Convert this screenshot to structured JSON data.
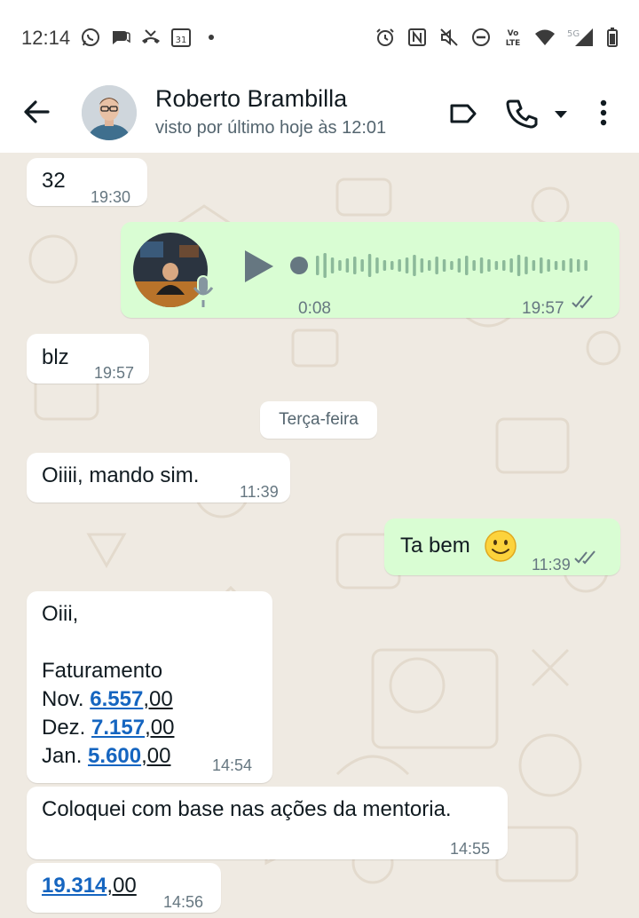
{
  "status_bar": {
    "time": "12:14",
    "left_icons": [
      "whatsapp-icon",
      "chat-icon",
      "missed-call-icon",
      "calendar-icon",
      "dot-icon"
    ],
    "calendar_day": "31",
    "right_icons": [
      "alarm-icon",
      "nfc-icon",
      "mute-icon",
      "dnd-icon",
      "volte-icon",
      "wifi-icon",
      "signal-icon",
      "battery-icon"
    ],
    "volte_label": "Vo LTE",
    "network_label": "5G"
  },
  "header": {
    "contact_name": "Roberto Brambilla",
    "contact_status": "visto por último hoje às 12:01",
    "icons": [
      "back-arrow-icon",
      "label-icon",
      "call-icon",
      "dropdown-icon",
      "more-icon"
    ]
  },
  "chat": {
    "date_separator": "Terça-feira",
    "messages": [
      {
        "dir": "in",
        "text": "32",
        "time": "19:30"
      },
      {
        "dir": "out",
        "type": "voice",
        "duration": "0:08",
        "time": "19:57",
        "status": "read"
      },
      {
        "dir": "in",
        "text": "blz",
        "time": "19:57"
      },
      {
        "dir": "in",
        "text": "Oiiii, mando sim.",
        "time": "11:39"
      },
      {
        "dir": "out",
        "text": "Ta bem",
        "emoji": "slightly-smiling-face",
        "time": "11:39",
        "status": "read"
      },
      {
        "dir": "in",
        "lines": {
          "greeting": "Oiii,",
          "heading": "Faturamento",
          "nov_label": "Nov.",
          "nov_num": "6.557",
          "nov_dec": ",00",
          "dez_label": "Dez.",
          "dez_num": "7.157",
          "dez_dec": ",00",
          "jan_label": "Jan.",
          "jan_num": "5.600",
          "jan_dec": ",00"
        },
        "time": "14:54"
      },
      {
        "dir": "in",
        "text": "Coloquei com base nas ações da mentoria.",
        "time": "14:55"
      },
      {
        "dir": "in",
        "num": "19.314",
        "dec": ",00",
        "time": "14:56"
      }
    ]
  },
  "colors": {
    "incoming_bubble": "#ffffff",
    "outgoing_bubble": "#d9fdd3",
    "chat_background": "#efeae2",
    "link_number": "#1565c0",
    "read_ticks": "#667781"
  }
}
